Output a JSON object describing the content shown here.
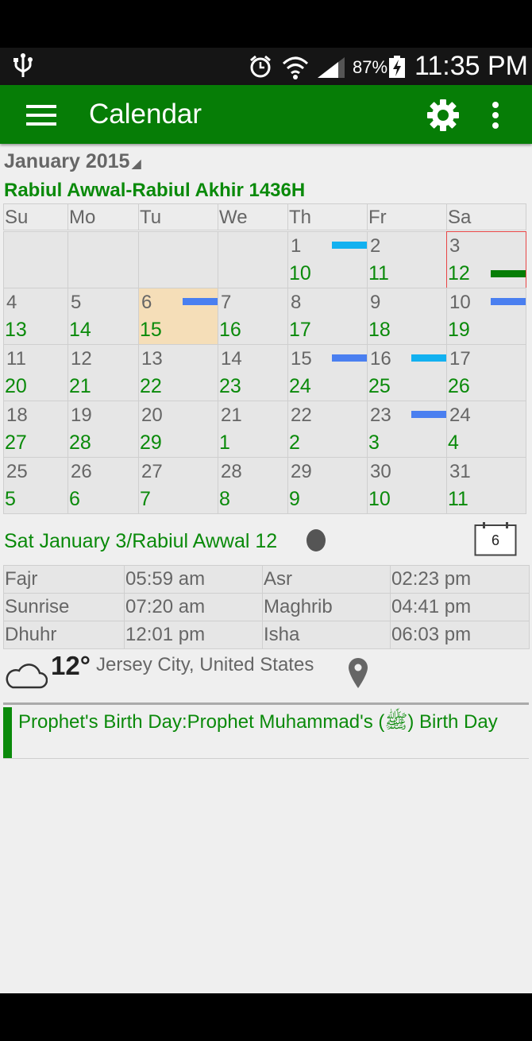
{
  "status": {
    "battery": "87%",
    "time": "11:35 PM"
  },
  "appbar": {
    "title": "Calendar"
  },
  "calendar": {
    "month": "January 2015",
    "hijri_range": "Rabiul Awwal-Rabiul Akhir 1436H",
    "weekdays": [
      "Su",
      "Mo",
      "Tu",
      "We",
      "Th",
      "Fr",
      "Sa"
    ],
    "weeks": [
      [
        null,
        null,
        null,
        null,
        {
          "g": "1",
          "h": "10",
          "ev": "cyan"
        },
        {
          "g": "2",
          "h": "11"
        },
        {
          "g": "3",
          "h": "12",
          "ev": "green",
          "selected": true
        }
      ],
      [
        {
          "g": "4",
          "h": "13"
        },
        {
          "g": "5",
          "h": "14"
        },
        {
          "g": "6",
          "h": "15",
          "ev": "blue",
          "today": true
        },
        {
          "g": "7",
          "h": "16"
        },
        {
          "g": "8",
          "h": "17"
        },
        {
          "g": "9",
          "h": "18"
        },
        {
          "g": "10",
          "h": "19",
          "ev": "blue"
        }
      ],
      [
        {
          "g": "11",
          "h": "20"
        },
        {
          "g": "12",
          "h": "21"
        },
        {
          "g": "13",
          "h": "22"
        },
        {
          "g": "14",
          "h": "23"
        },
        {
          "g": "15",
          "h": "24",
          "ev": "blue"
        },
        {
          "g": "16",
          "h": "25",
          "ev": "cyan"
        },
        {
          "g": "17",
          "h": "26"
        }
      ],
      [
        {
          "g": "18",
          "h": "27"
        },
        {
          "g": "19",
          "h": "28"
        },
        {
          "g": "20",
          "h": "29"
        },
        {
          "g": "21",
          "h": "1"
        },
        {
          "g": "22",
          "h": "2"
        },
        {
          "g": "23",
          "h": "3",
          "ev": "blue"
        },
        {
          "g": "24",
          "h": "4"
        }
      ],
      [
        {
          "g": "25",
          "h": "5"
        },
        {
          "g": "26",
          "h": "6"
        },
        {
          "g": "27",
          "h": "7"
        },
        {
          "g": "28",
          "h": "8"
        },
        {
          "g": "29",
          "h": "9"
        },
        {
          "g": "30",
          "h": "10"
        },
        {
          "g": "31",
          "h": "11"
        }
      ]
    ],
    "event_colors": {
      "blue": "#4a7ff0",
      "cyan": "#12b1f0",
      "green": "#067d06"
    }
  },
  "day": {
    "label": "Sat January 3/Rabiul Awwal 12",
    "today_button": "6"
  },
  "prayer_times": [
    [
      "Fajr",
      "05:59 am",
      "Asr",
      "02:23 pm"
    ],
    [
      "Sunrise",
      "07:20 am",
      "Maghrib",
      "04:41 pm"
    ],
    [
      "Dhuhr",
      "12:01 pm",
      "Isha",
      "06:03 pm"
    ]
  ],
  "weather": {
    "temp": "12°",
    "city": "Jersey City, United States"
  },
  "events": [
    {
      "text": "Prophet's Birth Day:Prophet Muhammad's (ﷺ) Birth Day"
    }
  ]
}
